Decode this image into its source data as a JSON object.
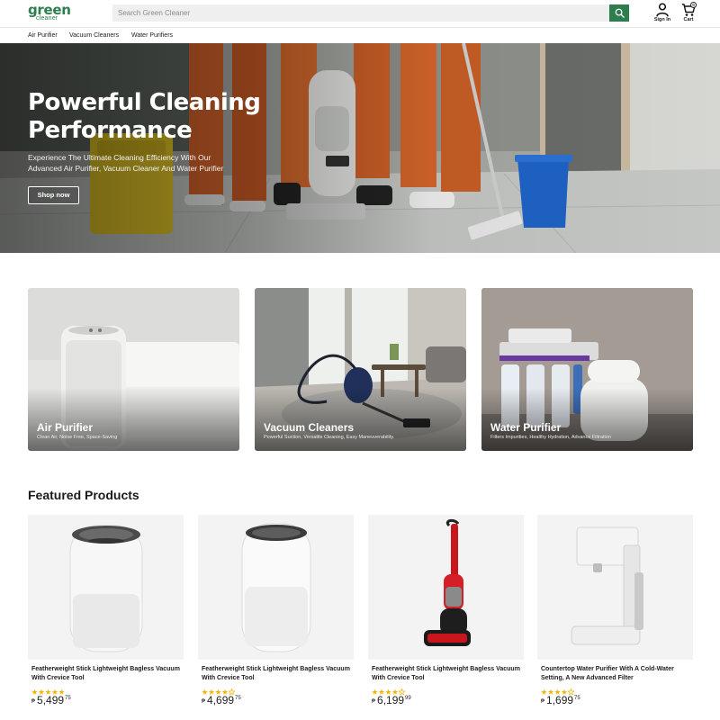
{
  "brand": {
    "name": "green",
    "sub": "cleaner",
    "color": "#2e7d4f"
  },
  "search": {
    "placeholder": "Search Green Cleaner",
    "icon": "search-icon"
  },
  "header": {
    "signin_label": "Sign In",
    "cart_label": "Cart",
    "cart_count": "0"
  },
  "nav": {
    "items": [
      {
        "label": "Air Purifier"
      },
      {
        "label": "Vacuum Cleaners"
      },
      {
        "label": "Water Purifiers"
      }
    ]
  },
  "hero": {
    "title": "Powerful Cleaning Performance",
    "subtitle": "Experience The Ultimate Cleaning Efficiency With Our Advanced Air Purifier, Vacuum Cleaner And Water Purifier",
    "cta": "Shop now"
  },
  "categories": [
    {
      "title": "Air Purifier",
      "desc": "Clean Air, Noise Free, Space-Saving"
    },
    {
      "title": "Vacuum Cleaners",
      "desc": "Powerful Suction, Versatile Cleaning, Easy Maneuverability."
    },
    {
      "title": "Water Purifier",
      "desc": "Filters Impurities, Healthy Hydration, Advance Filtration"
    }
  ],
  "featured": {
    "title": "Featured Products",
    "currency": "₱",
    "star_color": "#f4b400",
    "products": [
      {
        "name": "Featherweight Stick Lightweight Bagless Vacuum With Crevice Tool",
        "rating": 5,
        "price_main": "5,499",
        "price_cents": "75"
      },
      {
        "name": "Featherweight Stick Lightweight Bagless Vacuum With Crevice Tool",
        "rating": 4,
        "price_main": "4,699",
        "price_cents": "75"
      },
      {
        "name": "Featherweight Stick Lightweight Bagless Vacuum With Crevice Tool",
        "rating": 4,
        "price_main": "6,199",
        "price_cents": "99"
      },
      {
        "name": "Countertop Water Purifier With A Cold-Water Setting, A New Advanced Filter",
        "rating": 4,
        "price_main": "1,699",
        "price_cents": "75"
      }
    ]
  }
}
